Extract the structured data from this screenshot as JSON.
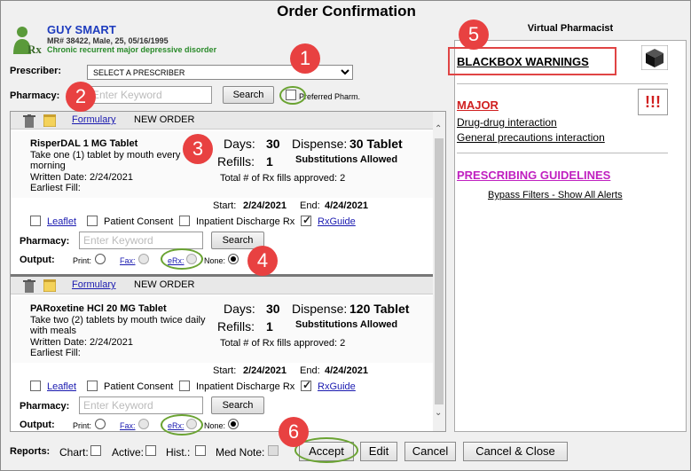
{
  "title": "Order Confirmation",
  "patient": {
    "name": "GUY SMART",
    "info": "MR# 38422, Male, 25, 05/16/1995",
    "diagnosis": "Chronic recurrent major depressive disorder"
  },
  "prescriber": {
    "label": "Prescriber:",
    "selected": "SELECT A PRESCRIBER"
  },
  "pharmacy": {
    "label": "Pharmacy:",
    "placeholder": "Enter Keyword",
    "search_label": "Search",
    "preferred_label": "Preferred Pharm."
  },
  "orders": [
    {
      "formulary": "Formulary",
      "status": "NEW ORDER",
      "drug": "RisperDAL 1 MG Tablet",
      "sig": "Take one (1) tablet by mouth every morning",
      "written": "Written Date: 2/24/2021",
      "earliest": "Earliest Fill:",
      "days_label": "Days:",
      "days": "30",
      "refills_label": "Refills:",
      "refills": "1",
      "dispense_label": "Dispense:",
      "dispense": "30 Tablet",
      "substitutions": "Substitutions Allowed",
      "fills": "Total # of Rx fills approved: 2",
      "start_label": "Start:",
      "start": "2/24/2021",
      "end_label": "End:",
      "end": "4/24/2021",
      "leaflet": "Leaflet",
      "consent": "Patient Consent",
      "discharge": "Inpatient Discharge Rx",
      "rxguide": "RxGuide",
      "pharmacy_label": "Pharmacy:",
      "pharmacy_placeholder": "Enter Keyword",
      "search": "Search",
      "output_label": "Output:",
      "print": "Print:",
      "fax": "Fax:",
      "erx": "eRx:",
      "none": "None:"
    },
    {
      "formulary": "Formulary",
      "status": "NEW ORDER",
      "drug": "PARoxetine HCl 20 MG Tablet",
      "sig": "Take two (2) tablets by mouth twice daily with meals",
      "written": "Written Date: 2/24/2021",
      "earliest": "Earliest Fill:",
      "days_label": "Days:",
      "days": "30",
      "refills_label": "Refills:",
      "refills": "1",
      "dispense_label": "Dispense:",
      "dispense": "120 Tablet",
      "substitutions": "Substitutions Allowed",
      "fills": "Total # of Rx fills approved: 2",
      "start_label": "Start:",
      "start": "2/24/2021",
      "end_label": "End:",
      "end": "4/24/2021",
      "leaflet": "Leaflet",
      "consent": "Patient Consent",
      "discharge": "Inpatient Discharge Rx",
      "rxguide": "RxGuide",
      "pharmacy_label": "Pharmacy:",
      "pharmacy_placeholder": "Enter Keyword",
      "search": "Search",
      "output_label": "Output:",
      "print": "Print:",
      "fax": "Fax:",
      "erx": "eRx:",
      "none": "None:"
    }
  ],
  "virtual_pharmacist": {
    "title": "Virtual Pharmacist",
    "blackbox": "BLACKBOX WARNINGS",
    "major": "MAJOR",
    "major_items": [
      "Drug-drug interaction",
      "General precautions interaction"
    ],
    "guidelines": "PRESCRIBING GUIDELINES",
    "bypass": "Bypass Filters - Show All Alerts",
    "alert_glyph": "!!!"
  },
  "footer": {
    "reports_label": "Reports:",
    "chart": "Chart:",
    "active": "Active:",
    "hist": "Hist.:",
    "mednote": "Med Note:",
    "accept": "Accept",
    "edit": "Edit",
    "cancel": "Cancel",
    "cancel_close": "Cancel & Close"
  },
  "callouts": [
    "1",
    "2",
    "3",
    "4",
    "5",
    "6"
  ],
  "colors": {
    "callout": "#e84141",
    "highlight_oval": "#6aa332",
    "major": "#d02020",
    "guidelines": "#c020c0",
    "link": "#1a1ab0"
  }
}
